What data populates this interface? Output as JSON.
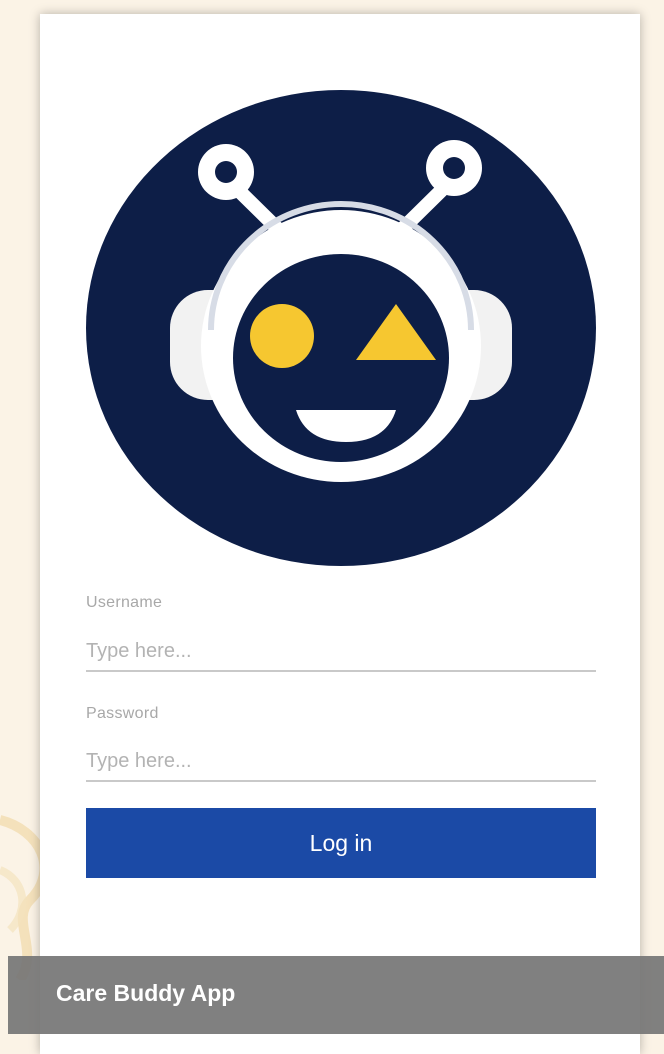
{
  "app": {
    "logo_icon": "robot-face-icon"
  },
  "login_form": {
    "username_label": "Username",
    "username_placeholder": "Type here...",
    "username_value": "",
    "password_label": "Password",
    "password_placeholder": "Type here...",
    "password_value": "",
    "login_label": "Log in"
  },
  "caption": {
    "text": "Care Buddy App"
  },
  "colors": {
    "logo_background": "#0d1e47",
    "accent_yellow": "#f6c730",
    "button": "#1b4aa6",
    "caption_bar": "#767676"
  }
}
